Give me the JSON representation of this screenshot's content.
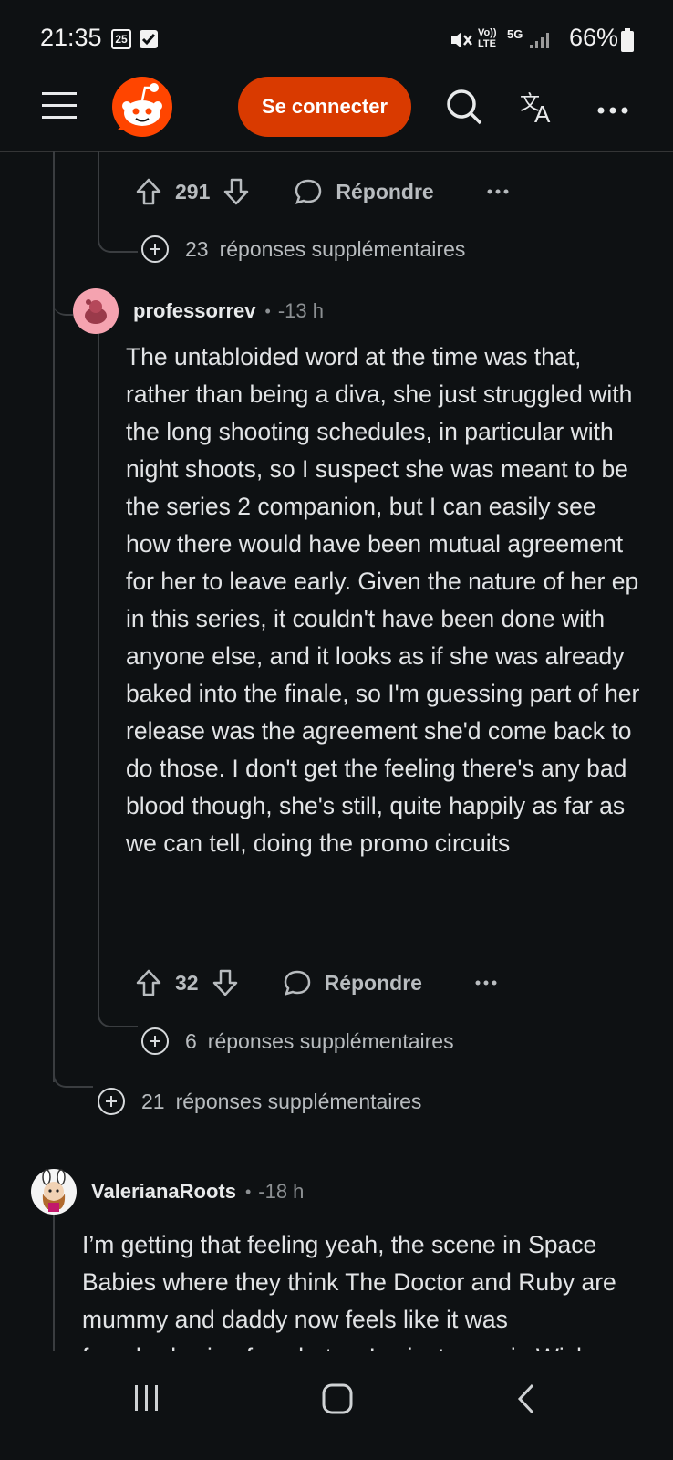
{
  "status_bar": {
    "time": "21:35",
    "calendar_day": "25",
    "network": "5G",
    "volte": "Vo)) LTE",
    "battery": "66%"
  },
  "app_bar": {
    "login_label": "Se connecter"
  },
  "comments": [
    {
      "id": "c1-tail",
      "votes": "291",
      "reply_label": "Répondre",
      "more_replies_count": "23",
      "more_replies_label": "réponses supplémentaires"
    },
    {
      "id": "c2",
      "author": "professorrev",
      "age": "-13 h",
      "body": "The untabloided word at the time was that, rather than being a diva, she just struggled with the long shooting schedules, in particular with night shoots, so I suspect she was meant to be the series 2 companion, but I can easily see how there would have been mutual agreement for her to leave early. Given the nature of her ep in this series, it couldn't have been done with anyone else, and it looks as if she was already baked into the finale, so I'm guessing part of her release was the agreement she'd come back to do those. I don't get the feeling there's any bad blood though, she's still, quite happily as far as we can tell, doing the promo circuits",
      "votes": "32",
      "reply_label": "Répondre",
      "more_replies_count": "6",
      "more_replies_label": "réponses supplémentaires"
    },
    {
      "id": "parent-more",
      "more_replies_count": "21",
      "more_replies_label": "réponses supplémentaires"
    },
    {
      "id": "c3",
      "author": "ValerianaRoots",
      "age": "-18 h",
      "body": "I’m getting that feeling yeah, the scene in Space Babies where they think The Doctor and Ruby are mummy and daddy now feels like it was foreshadowing for what we’ve just seen in Wish"
    }
  ],
  "colors": {
    "accent": "#d93a00",
    "background": "#0e1113",
    "text": "#d7dadc",
    "muted": "#8c9093"
  }
}
